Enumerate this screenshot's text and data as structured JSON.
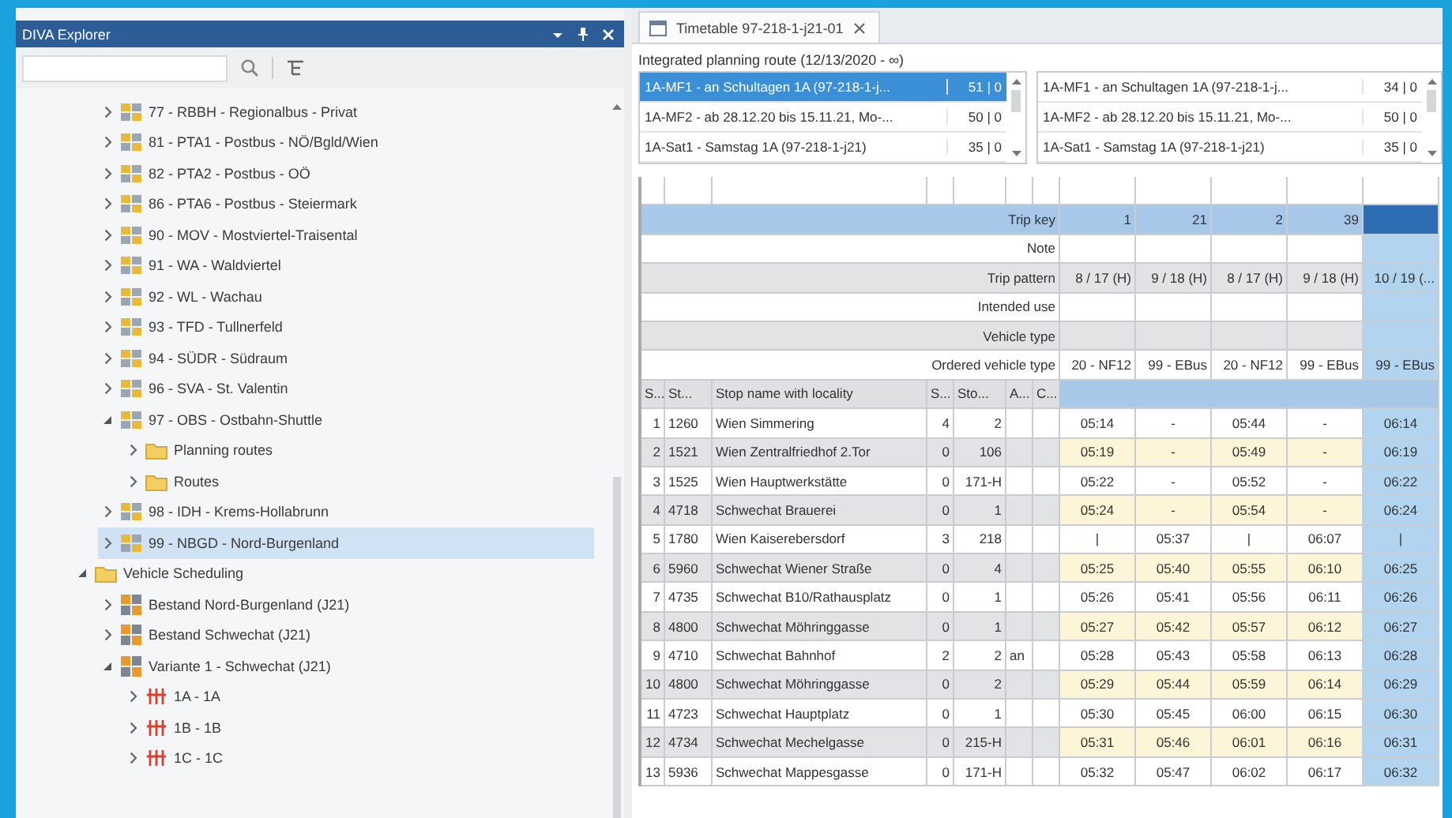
{
  "explorer": {
    "title": "DIVA Explorer",
    "tree": [
      {
        "children": [
          {
            "label": "77 - RBBH - Regionalbus - Privat",
            "kind": "operator",
            "expanded": false,
            "selected": false
          },
          {
            "label": "81 - PTA1 - Postbus - NÖ/Bgld/Wien",
            "kind": "operator",
            "expanded": false,
            "selected": false
          },
          {
            "label": "82 - PTA2 - Postbus - OÖ",
            "kind": "operator",
            "expanded": false,
            "selected": false
          },
          {
            "label": "86 - PTA6 - Postbus - Steiermark",
            "kind": "operator",
            "expanded": false,
            "selected": false
          },
          {
            "label": "90 - MOV - Mostviertel-Traisental",
            "kind": "operator",
            "expanded": false,
            "selected": false
          },
          {
            "label": "91 - WA - Waldviertel",
            "kind": "operator",
            "expanded": false,
            "selected": false
          },
          {
            "label": "92 - WL - Wachau",
            "kind": "operator",
            "expanded": false,
            "selected": false
          },
          {
            "label": "93 - TFD - Tullnerfeld",
            "kind": "operator",
            "expanded": false,
            "selected": false
          },
          {
            "label": "94 - SÜDR - Südraum",
            "kind": "operator",
            "expanded": false,
            "selected": false
          },
          {
            "label": "96 - SVA - St. Valentin",
            "kind": "operator",
            "expanded": false,
            "selected": false
          },
          {
            "label": "97 - OBS - Ostbahn-Shuttle",
            "kind": "operator",
            "expanded": true,
            "selected": false,
            "children": [
              {
                "label": "Planning routes",
                "kind": "folder",
                "expanded": false,
                "selected": false
              },
              {
                "label": "Routes",
                "kind": "folder",
                "expanded": false,
                "selected": false
              }
            ]
          },
          {
            "label": "98 - IDH - Krems-Hollabrunn",
            "kind": "operator",
            "expanded": false,
            "selected": false
          },
          {
            "label": "99 - NBGD - Nord-Burgenland",
            "kind": "operator",
            "expanded": false,
            "selected": true
          }
        ]
      },
      {
        "label": "Vehicle Scheduling",
        "kind": "folder",
        "expanded": true,
        "selected": false,
        "children": [
          {
            "label": "Bestand Nord-Burgenland (J21)",
            "kind": "block",
            "expanded": false,
            "selected": false
          },
          {
            "label": "Bestand Schwechat (J21)",
            "kind": "block",
            "expanded": false,
            "selected": false
          },
          {
            "label": "Variante 1 - Schwechat (J21)",
            "kind": "block",
            "expanded": true,
            "selected": false,
            "children": [
              {
                "label": "1A - 1A",
                "kind": "line",
                "expanded": false,
                "selected": false
              },
              {
                "label": "1B - 1B",
                "kind": "line",
                "expanded": false,
                "selected": false
              },
              {
                "label": "1C - 1C",
                "kind": "line",
                "expanded": false,
                "selected": false
              }
            ]
          }
        ]
      }
    ]
  },
  "document_tab": {
    "title": "Timetable 97-218-1-j21-01",
    "selected": true
  },
  "planning_route_label": "Integrated planning route (12/13/2020 - ∞)",
  "route_lists": [
    {
      "items": [
        {
          "name": "1A-MF1 - an Schultagen 1A (97-218-1-j...",
          "count": "51 | 0",
          "selected": true
        },
        {
          "name": "1A-MF2 - ab 28.12.20 bis 15.11.21, Mo-...",
          "count": "50 | 0",
          "selected": false
        },
        {
          "name": "1A-Sat1 - Samstag 1A (97-218-1-j21)",
          "count": "35 | 0",
          "selected": false
        }
      ]
    },
    {
      "items": [
        {
          "name": "1A-MF1 - an Schultagen 1A (97-218-1-j...",
          "count": "34 | 0",
          "selected": false
        },
        {
          "name": "1A-MF2 - ab 28.12.20 bis 15.11.21, Mo-...",
          "count": "50 | 0",
          "selected": false
        },
        {
          "name": "1A-Sat1 - Samstag 1A (97-218-1-j21)",
          "count": "35 | 0",
          "selected": false
        }
      ]
    }
  ],
  "timetable": {
    "trip_columns": [
      {
        "selected": false
      },
      {
        "selected": false
      },
      {
        "selected": false
      },
      {
        "selected": false
      },
      {
        "selected": true
      }
    ],
    "meta_rows": [
      {
        "label": "Trip key",
        "kind": "key",
        "values": [
          "1",
          "21",
          "2",
          "39"
        ]
      },
      {
        "label": "Note",
        "kind": "plain"
      },
      {
        "label": "Trip pattern",
        "kind": "plain",
        "values": [
          "8 / 17 (H)",
          "9 / 18 (H)",
          "8 / 17 (H)",
          "9 / 18 (H)",
          "10 / 19 (..."
        ]
      },
      {
        "label": "Intended use",
        "kind": "plain"
      },
      {
        "label": "Vehicle type",
        "kind": "plain"
      },
      {
        "label": "Ordered vehicle type",
        "kind": "plain",
        "values": [
          "20 - NF12",
          "99 - EBus",
          "20 - NF12",
          "99 - EBus",
          "99 - EBus"
        ]
      }
    ],
    "columns": [
      "S...",
      "St...",
      "Stop name with locality",
      "S...",
      "Sto...",
      "A...",
      "C..."
    ],
    "rows": [
      {
        "seq": "1",
        "stop_no": "1260",
        "name": "Wien Simmering",
        "col_4": "4",
        "col_5": "2",
        "times": [
          "05:14",
          "-",
          "05:44",
          "-",
          "06:14"
        ]
      },
      {
        "seq": "2",
        "stop_no": "1521",
        "name": "Wien Zentralfriedhof 2.Tor",
        "col_4": "0",
        "col_5": "106",
        "times": [
          "05:19",
          "-",
          "05:49",
          "-",
          "06:19"
        ]
      },
      {
        "seq": "3",
        "stop_no": "1525",
        "name": "Wien Hauptwerkstätte",
        "col_4": "0",
        "col_5": "171-H",
        "times": [
          "05:22",
          "-",
          "05:52",
          "-",
          "06:22"
        ]
      },
      {
        "seq": "4",
        "stop_no": "4718",
        "name": "Schwechat Brauerei",
        "col_4": "0",
        "col_5": "1",
        "times": [
          "05:24",
          "-",
          "05:54",
          "-",
          "06:24"
        ]
      },
      {
        "seq": "5",
        "stop_no": "1780",
        "name": "Wien Kaiserebersdorf",
        "col_4": "3",
        "col_5": "218",
        "times": [
          "|",
          "05:37",
          "|",
          "06:07",
          "|"
        ]
      },
      {
        "seq": "6",
        "stop_no": "5960",
        "name": "Schwechat Wiener Straße",
        "col_4": "0",
        "col_5": "4",
        "times": [
          "05:25",
          "05:40",
          "05:55",
          "06:10",
          "06:25"
        ]
      },
      {
        "seq": "7",
        "stop_no": "4735",
        "name": "Schwechat B10/Rathausplatz",
        "col_4": "0",
        "col_5": "1",
        "times": [
          "05:26",
          "05:41",
          "05:56",
          "06:11",
          "06:26"
        ]
      },
      {
        "seq": "8",
        "stop_no": "4800",
        "name": "Schwechat Möhringgasse",
        "col_4": "0",
        "col_5": "1",
        "times": [
          "05:27",
          "05:42",
          "05:57",
          "06:12",
          "06:27"
        ]
      },
      {
        "seq": "9",
        "stop_no": "4710",
        "name": "Schwechat Bahnhof",
        "col_4": "2",
        "col_5": "2",
        "col_6": "an",
        "times": [
          "05:28",
          "05:43",
          "05:58",
          "06:13",
          "06:28"
        ]
      },
      {
        "seq": "10",
        "stop_no": "4800",
        "name": "Schwechat Möhringgasse",
        "col_4": "0",
        "col_5": "2",
        "times": [
          "05:29",
          "05:44",
          "05:59",
          "06:14",
          "06:29"
        ]
      },
      {
        "seq": "11",
        "stop_no": "4723",
        "name": "Schwechat Hauptplatz",
        "col_4": "0",
        "col_5": "1",
        "times": [
          "05:30",
          "05:45",
          "06:00",
          "06:15",
          "06:30"
        ]
      },
      {
        "seq": "12",
        "stop_no": "4734",
        "name": "Schwechat Mechelgasse",
        "col_4": "0",
        "col_5": "215-H",
        "times": [
          "05:31",
          "05:46",
          "06:01",
          "06:16",
          "06:31"
        ]
      },
      {
        "seq": "13",
        "stop_no": "5936",
        "name": "Schwechat Mappesgasse",
        "col_4": "0",
        "col_5": "171-H",
        "times": [
          "05:32",
          "05:47",
          "06:02",
          "06:17",
          "06:32"
        ]
      }
    ]
  }
}
